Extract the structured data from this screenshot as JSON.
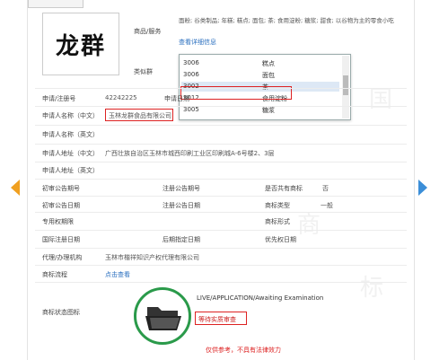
{
  "logo_text": "龙群",
  "goods_services": {
    "label": "商品/服务",
    "text": "面粉; 谷类制品; 年糕; 糕点; 面包; 茶; 食用淀粉; 糖浆; 甜食; 以谷物为主的零食小吃",
    "detail_link": "查看详细信息"
  },
  "class_group_label": "类似群",
  "dropdown": {
    "rows": [
      {
        "code": "3006",
        "name": "糕点"
      },
      {
        "code": "3006",
        "name": "面包"
      },
      {
        "code": "3002",
        "name": "茶"
      },
      {
        "code": "3012",
        "name": "食用淀粉"
      },
      {
        "code": "3005",
        "name": "糖浆"
      }
    ]
  },
  "fields": {
    "reg_no_label": "申请/注册号",
    "reg_no_value": "42242225",
    "reg_date_label": "申请日期",
    "applicant_cn_label": "申请人名称（中文）",
    "applicant_cn_value": "玉林龙群食品有限公司",
    "applicant_en_label": "申请人名称（英文）",
    "address_cn_label": "申请人地址（中文）",
    "address_cn_value": "广西壮族自治区玉林市城西印刷工业区印刷城A-6号楼2、3层",
    "address_en_label": "申请人地址（英文）",
    "first_pub_no_label": "初审公告期号",
    "reg_pub_no_label": "注册公告期号",
    "shared_label": "是否共有商标",
    "shared_value": "否",
    "first_pub_date_label": "初审公告日期",
    "reg_pub_date_label": "注册公告日期",
    "mark_type_label": "商标类型",
    "mark_type_value": "一般",
    "exclusive_label": "专用权期限",
    "mark_form_label": "商标形式",
    "intl_reg_label": "国际注册日期",
    "later_date_label": "后期指定日期",
    "priority_label": "优先权日期",
    "agent_label": "代理/办理机构",
    "agent_value": "玉林市楷祥知识产权代理有限公司",
    "process_label": "商标流程",
    "process_link": "点击查看",
    "status_label": "商标状态图标",
    "status_en": "LIVE/APPLICATION/Awaiting Examination",
    "status_cn": "等待实质审查",
    "disclaimer": "仅供参考，不具有法律效力"
  },
  "colors": {
    "accent": "#2a6fbf",
    "red": "#dd2222",
    "green": "#2a9a4a",
    "orange": "#f0a020"
  }
}
